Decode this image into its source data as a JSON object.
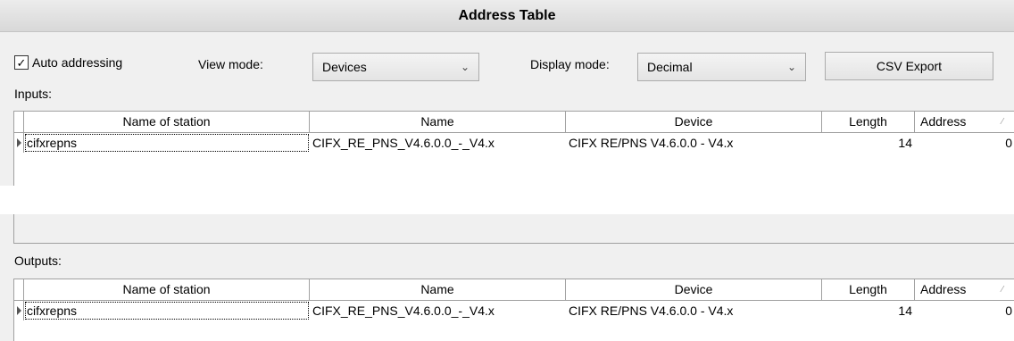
{
  "title": "Address Table",
  "auto_addressing": {
    "label": "Auto addressing",
    "checked": true
  },
  "view_mode": {
    "label": "View mode:",
    "value": "Devices"
  },
  "display_mode": {
    "label": "Display mode:",
    "value": "Decimal"
  },
  "csv_export": {
    "label": "CSV Export"
  },
  "inputs": {
    "label": "Inputs:",
    "columns": [
      "Name of station",
      "Name",
      "Device",
      "Length",
      "Address"
    ],
    "rows": [
      {
        "station": "cifxrepns",
        "name": "CIFX_RE_PNS_V4.6.0.0_-_V4.x",
        "device": "CIFX RE/PNS V4.6.0.0 - V4.x",
        "length": "14",
        "address": "0"
      }
    ]
  },
  "outputs": {
    "label": "Outputs:",
    "columns": [
      "Name of station",
      "Name",
      "Device",
      "Length",
      "Address"
    ],
    "rows": [
      {
        "station": "cifxrepns",
        "name": "CIFX_RE_PNS_V4.6.0.0_-_V4.x",
        "device": "CIFX RE/PNS V4.6.0.0 - V4.x",
        "length": "14",
        "address": "0"
      }
    ]
  },
  "icons": {
    "checkbox": "check-mark",
    "dropdown": "chevron-down-icon",
    "row_indicator": "triangle-right",
    "sort": "sort-ascending-icon"
  }
}
